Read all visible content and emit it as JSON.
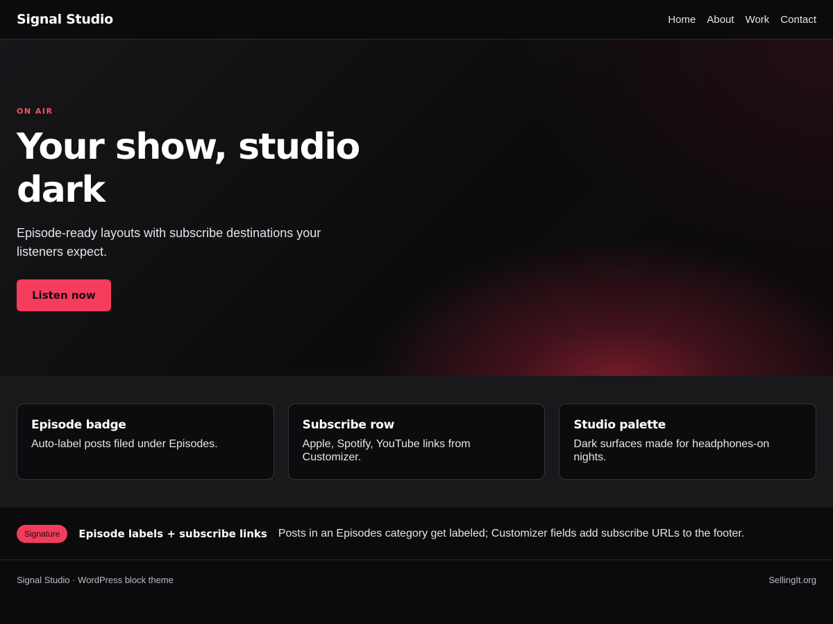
{
  "header": {
    "brand": "Signal Studio",
    "nav": [
      "Home",
      "About",
      "Work",
      "Contact"
    ]
  },
  "hero": {
    "kicker": "ON AIR",
    "title": "Your show, studio dark",
    "subtitle": "Episode-ready layouts with subscribe destinations your listeners expect.",
    "cta_label": "Listen now"
  },
  "features": [
    {
      "title": "Episode badge",
      "text": "Auto-label posts filed under Episodes."
    },
    {
      "title": "Subscribe row",
      "text": "Apple, Spotify, YouTube links from Customizer."
    },
    {
      "title": "Studio palette",
      "text": "Dark surfaces made for headphones-on nights."
    }
  ],
  "signature": {
    "badge": "Signature",
    "title": "Episode labels + subscribe links",
    "text": "Posts in an Episodes category get labeled; Customizer fields add subscribe URLs to the footer."
  },
  "footer": {
    "left": "Signal Studio · WordPress block theme",
    "right": "SellingIt.org"
  },
  "colors": {
    "accent": "#f43d5c",
    "background": "#0b0b0d",
    "surface": "#19191c"
  }
}
